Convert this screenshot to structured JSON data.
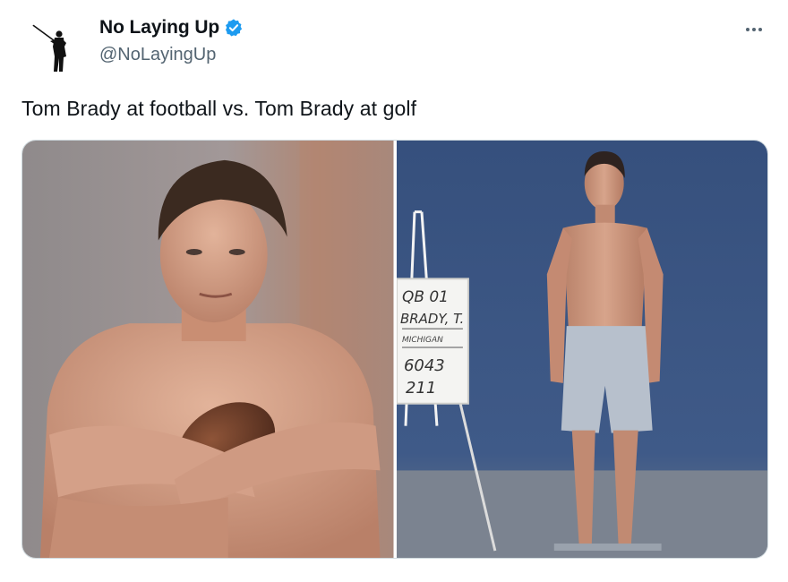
{
  "tweet": {
    "author": {
      "display_name": "No Laying Up",
      "handle": "@NoLayingUp",
      "verified": true,
      "avatar_icon": "golfer-silhouette-icon",
      "verified_icon": "verified-badge-icon",
      "verified_color": "#1d9bf0"
    },
    "more_icon": "more-options-icon",
    "text": "Tom Brady at football vs. Tom Brady at golf",
    "media": [
      {
        "id": "photo-football",
        "icon": "portrait-photo",
        "accent": "#9b7a6a"
      },
      {
        "id": "photo-golf",
        "icon": "combine-photo",
        "accent": "#3f5a88"
      }
    ],
    "sign": {
      "line1": "QB 01",
      "line2": "BRADY, T.",
      "line3": "MICHIGAN",
      "line4": "6043",
      "line5": "211"
    }
  }
}
